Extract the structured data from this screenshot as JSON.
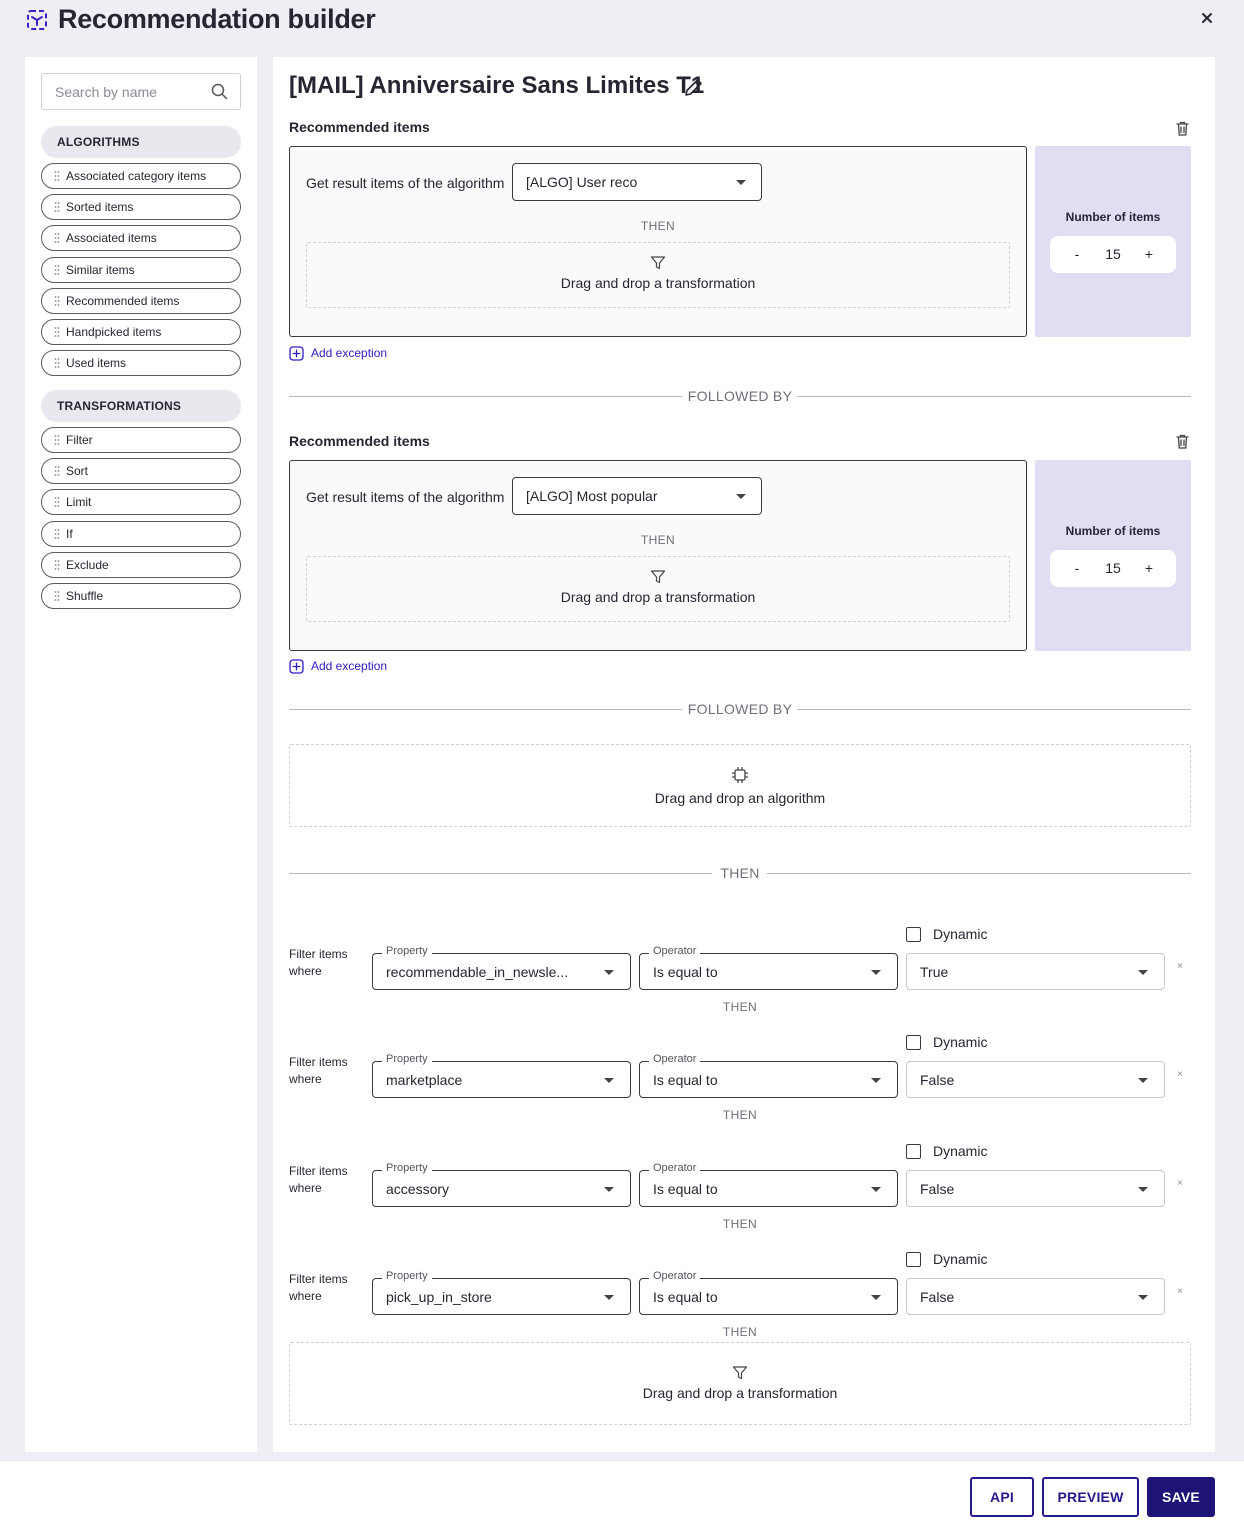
{
  "header": {
    "title": "Recommendation builder",
    "logo_icon": "brand-logo-icon",
    "close_icon": "close-icon"
  },
  "sidebar": {
    "search_placeholder": "Search by name",
    "algorithms_title": "ALGORITHMS",
    "algorithms": [
      "Associated category items",
      "Sorted items",
      "Associated items",
      "Similar items",
      "Recommended items",
      "Handpicked items",
      "Used items"
    ],
    "transformations_title": "TRANSFORMATIONS",
    "transformations": [
      "Filter",
      "Sort",
      "Limit",
      "If",
      "Exclude",
      "Shuffle"
    ]
  },
  "main": {
    "recommendation_name": "[MAIL] Anniversaire Sans Limites T1",
    "blocks": [
      {
        "label": "Recommended items",
        "get_label": "Get result items of the algorithm",
        "algorithm": "[ALGO] User reco",
        "then": "THEN",
        "transformation_drop": "Drag and drop a transformation",
        "number_label": "Number of items",
        "minus": "-",
        "count": "15",
        "plus": "+",
        "add_exception": "Add exception"
      },
      {
        "label": "Recommended items",
        "get_label": "Get result items of the algorithm",
        "algorithm": "[ALGO] Most popular",
        "then": "THEN",
        "transformation_drop": "Drag and drop a transformation",
        "number_label": "Number of items",
        "minus": "-",
        "count": "15",
        "plus": "+",
        "add_exception": "Add exception"
      }
    ],
    "followed_by": "FOLLOWED BY",
    "algorithm_drop": "Drag and drop an algorithm",
    "then_divider": "THEN",
    "filters": [
      {
        "where": "Filter items where",
        "property_label": "Property",
        "property": "recommendable_in_newsle...",
        "operator_label": "Operator",
        "operator": "Is equal to",
        "dynamic": "Dynamic",
        "value": "True",
        "remove": "×",
        "then": "THEN"
      },
      {
        "where": "Filter items where",
        "property_label": "Property",
        "property": "marketplace",
        "operator_label": "Operator",
        "operator": "Is equal to",
        "dynamic": "Dynamic",
        "value": "False",
        "remove": "×",
        "then": "THEN"
      },
      {
        "where": "Filter items where",
        "property_label": "Property",
        "property": "accessory",
        "operator_label": "Operator",
        "operator": "Is equal to",
        "dynamic": "Dynamic",
        "value": "False",
        "remove": "×",
        "then": "THEN"
      },
      {
        "where": "Filter items where",
        "property_label": "Property",
        "property": "pick_up_in_store",
        "operator_label": "Operator",
        "operator": "Is equal to",
        "dynamic": "Dynamic",
        "value": "False",
        "remove": "×",
        "then": "THEN"
      }
    ],
    "final_transformation_drop": "Drag and drop a transformation"
  },
  "footer": {
    "api": "API",
    "preview": "PREVIEW",
    "save": "SAVE"
  },
  "colors": {
    "accent": "#1e1477",
    "link": "#2d1dc4",
    "panel": "#e3ddf3",
    "background": "#efeef4"
  }
}
